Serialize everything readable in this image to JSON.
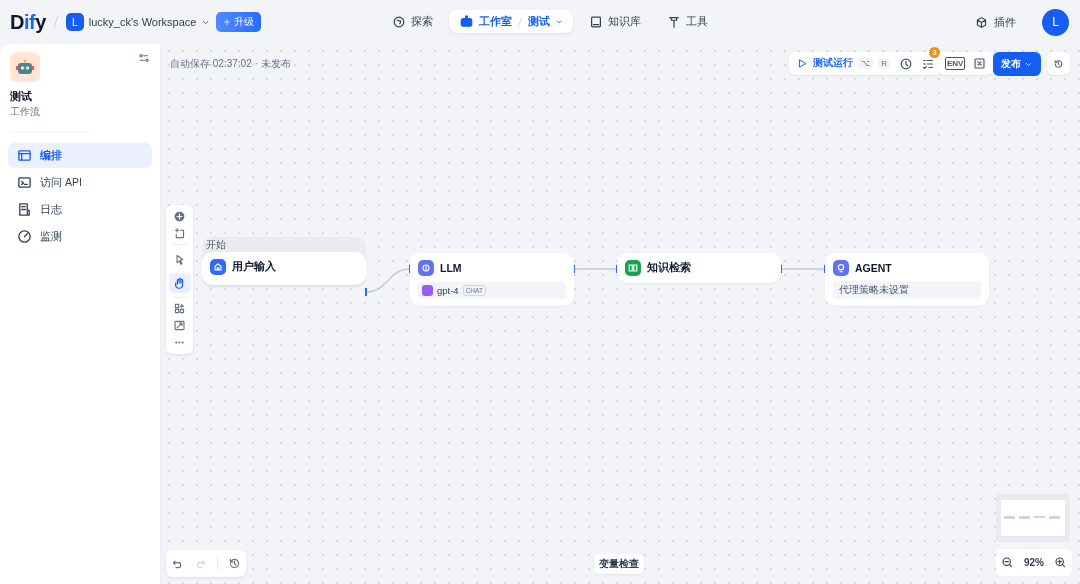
{
  "header": {
    "logo": [
      {
        "text": "D",
        "accent": false
      },
      {
        "text": "if",
        "accent": true
      },
      {
        "text": "y",
        "accent": false
      }
    ],
    "workspace": {
      "initial": "L",
      "name": "lucky_ck's Workspace"
    },
    "upgrade_button": "升级",
    "nav": [
      {
        "kind": "explore",
        "label": "探索",
        "selected": false
      },
      {
        "kind": "studio",
        "label": "工作室",
        "sub": "测试",
        "selected": true
      },
      {
        "kind": "knowledge",
        "label": "知识库",
        "selected": false
      },
      {
        "kind": "tools",
        "label": "工具",
        "selected": false
      }
    ],
    "plugins": "插件",
    "avatar": "L"
  },
  "sidebar": {
    "app": {
      "name": "测试",
      "type": "工作流"
    },
    "items": [
      {
        "kind": "orchestrate",
        "label": "编排",
        "selected": true
      },
      {
        "kind": "api",
        "label": "访问 API",
        "selected": false
      },
      {
        "kind": "logs",
        "label": "日志",
        "selected": false
      },
      {
        "kind": "monitor",
        "label": "监测",
        "selected": false
      }
    ]
  },
  "canvas": {
    "autosave": "自动保存 02:37:02 · 未发布",
    "run_button": {
      "label": "测试运行",
      "keys": [
        "⌥",
        "R"
      ]
    },
    "checklist_count": "3",
    "env_label": "ENV",
    "publish_button": "发布",
    "tools": [
      {
        "kind": "pointer",
        "selected": false
      },
      {
        "kind": "hand",
        "selected": true
      }
    ],
    "nodes": [
      {
        "kind": "start",
        "group": "开始",
        "title": "用户输入"
      },
      {
        "kind": "llm",
        "title": "LLM",
        "model": "gpt-4",
        "mode": "CHAT"
      },
      {
        "kind": "knowledge",
        "title": "知识检索"
      },
      {
        "kind": "agent",
        "title": "AGENT",
        "note": "代理策略未设置"
      }
    ],
    "variable_inspect": "变量检查",
    "zoom": "92%"
  }
}
